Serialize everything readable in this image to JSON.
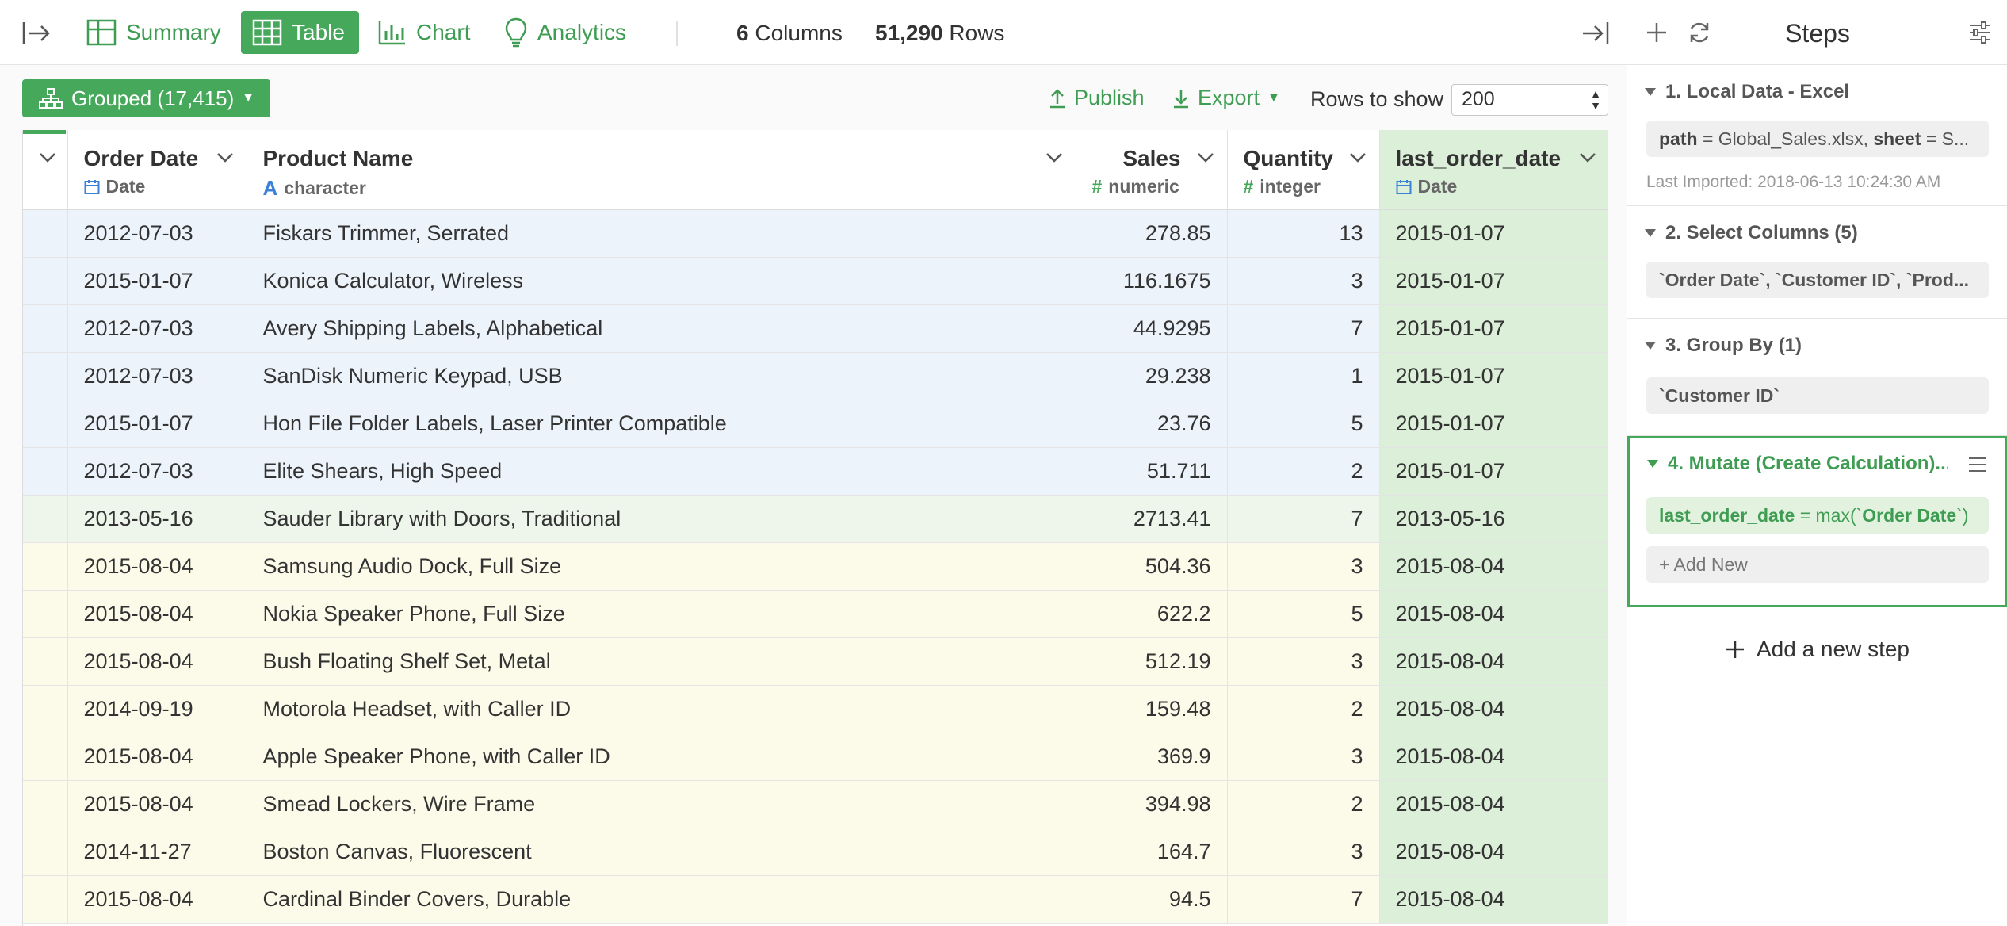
{
  "tabs": [
    {
      "label": "Summary",
      "icon": "summary-grid-icon"
    },
    {
      "label": "Table",
      "icon": "table-icon",
      "active": true
    },
    {
      "label": "Chart",
      "icon": "bar-chart-icon"
    },
    {
      "label": "Analytics",
      "icon": "lightbulb-icon"
    }
  ],
  "stats": {
    "columns_count": "6",
    "columns_label": "Columns",
    "rows_count": "51,290",
    "rows_label": "Rows"
  },
  "toolbar": {
    "grouped_label": "Grouped (17,415)",
    "publish_label": "Publish",
    "export_label": "Export",
    "rows_to_show_label": "Rows to show",
    "rows_to_show_value": "200"
  },
  "columns": [
    {
      "name": "Order Date",
      "type": "Date",
      "type_icon": "calendar-icon"
    },
    {
      "name": "Product Name",
      "type": "character",
      "type_icon": "character-type-icon"
    },
    {
      "name": "Sales",
      "type": "numeric",
      "type_icon": "numeric-type-icon"
    },
    {
      "name": "Quantity",
      "type": "integer",
      "type_icon": "numeric-type-icon"
    },
    {
      "name": "last_order_date",
      "type": "Date",
      "type_icon": "calendar-icon"
    }
  ],
  "rows": [
    {
      "group": 1,
      "cells": [
        "2012-07-03",
        "Fiskars Trimmer, Serrated",
        "278.85",
        "13",
        "2015-01-07"
      ]
    },
    {
      "group": 1,
      "cells": [
        "2015-01-07",
        "Konica Calculator, Wireless",
        "116.1675",
        "3",
        "2015-01-07"
      ]
    },
    {
      "group": 1,
      "cells": [
        "2012-07-03",
        "Avery Shipping Labels, Alphabetical",
        "44.9295",
        "7",
        "2015-01-07"
      ]
    },
    {
      "group": 1,
      "cells": [
        "2012-07-03",
        "SanDisk Numeric Keypad, USB",
        "29.238",
        "1",
        "2015-01-07"
      ]
    },
    {
      "group": 1,
      "cells": [
        "2015-01-07",
        "Hon File Folder Labels, Laser Printer Compatible",
        "23.76",
        "5",
        "2015-01-07"
      ]
    },
    {
      "group": 1,
      "cells": [
        "2012-07-03",
        "Elite Shears, High Speed",
        "51.711",
        "2",
        "2015-01-07"
      ]
    },
    {
      "group": 2,
      "cells": [
        "2013-05-16",
        "Sauder Library with Doors, Traditional",
        "2713.41",
        "7",
        "2013-05-16"
      ]
    },
    {
      "group": 3,
      "cells": [
        "2015-08-04",
        "Samsung Audio Dock, Full Size",
        "504.36",
        "3",
        "2015-08-04"
      ]
    },
    {
      "group": 3,
      "cells": [
        "2015-08-04",
        "Nokia Speaker Phone, Full Size",
        "622.2",
        "5",
        "2015-08-04"
      ]
    },
    {
      "group": 3,
      "cells": [
        "2015-08-04",
        "Bush Floating Shelf Set, Metal",
        "512.19",
        "3",
        "2015-08-04"
      ]
    },
    {
      "group": 3,
      "cells": [
        "2014-09-19",
        "Motorola Headset, with Caller ID",
        "159.48",
        "2",
        "2015-08-04"
      ]
    },
    {
      "group": 3,
      "cells": [
        "2015-08-04",
        "Apple Speaker Phone, with Caller ID",
        "369.9",
        "3",
        "2015-08-04"
      ]
    },
    {
      "group": 3,
      "cells": [
        "2015-08-04",
        "Smead Lockers, Wire Frame",
        "394.98",
        "2",
        "2015-08-04"
      ]
    },
    {
      "group": 3,
      "cells": [
        "2014-11-27",
        "Boston Canvas, Fluorescent",
        "164.7",
        "3",
        "2015-08-04"
      ]
    },
    {
      "group": 3,
      "cells": [
        "2015-08-04",
        "Cardinal Binder Covers, Durable",
        "94.5",
        "7",
        "2015-08-04"
      ]
    }
  ],
  "sidebar": {
    "title": "Steps",
    "steps": [
      {
        "title": "1. Local Data - Excel",
        "box_key1": "path",
        "box_eq1": " = Global_Sales.xlsx, ",
        "box_key2": "sheet",
        "box_eq2": " = S...",
        "note": "Last Imported: 2018-06-13 10:24:30 AM"
      },
      {
        "title": "2. Select Columns (5)",
        "box": "`Order Date`, `Customer ID`, `Prod..."
      },
      {
        "title": "3. Group By (1)",
        "box": "`Customer ID`"
      },
      {
        "title": "4. Mutate (Create Calculation)...",
        "box_key": "last_order_date",
        "box_mid": " = max(`",
        "box_key2": "Order Date",
        "box_end": "`)",
        "add_new": "+ Add New"
      }
    ],
    "add_step_label": "Add a new step"
  },
  "colors": {
    "accent": "#45a85a",
    "accent_text": "#3e9d52",
    "group1": "#edf3fb",
    "group2": "#eef5ea",
    "group3": "#fcfbea",
    "new_column": "#dcefd9"
  }
}
